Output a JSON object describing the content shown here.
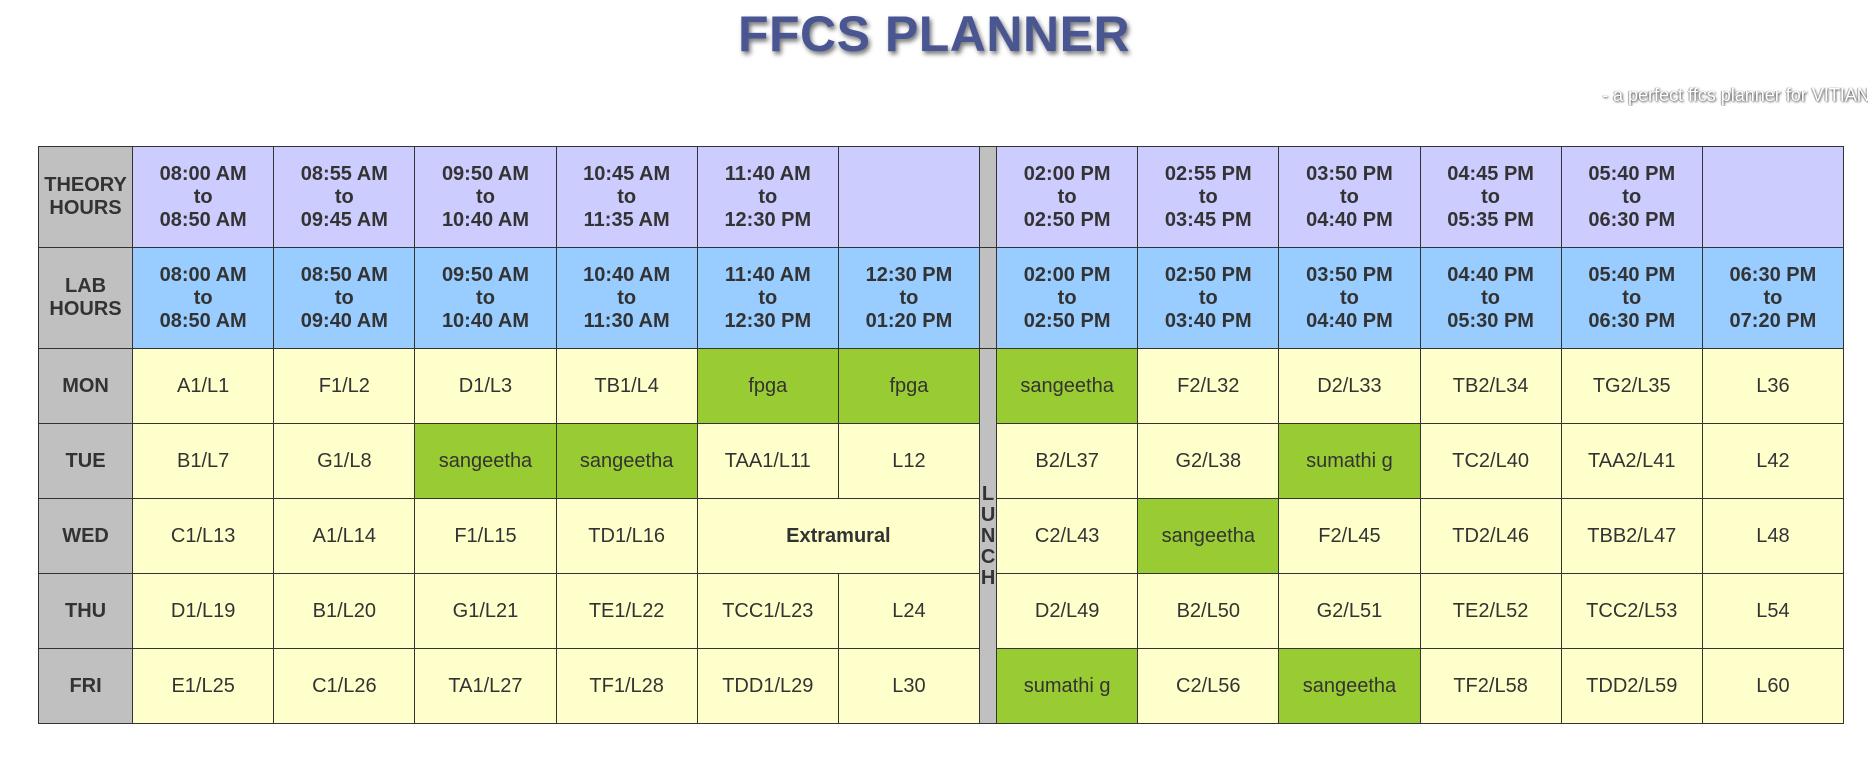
{
  "header": {
    "title": "FFCS PLANNER",
    "subtitle": "- a perfect ffcs planner for VITIAN"
  },
  "colors": {
    "label_gray": "#c0c0c0",
    "theory_purple": "#ccccff",
    "lab_blue": "#99ccff",
    "slot_yellow": "#ffffcc",
    "selected_green": "#99cc33",
    "extramural_red": "#b31b1b",
    "title_blue": "#4a5692"
  },
  "theory_row": {
    "label_1": "THEORY",
    "label_2": "HOURS",
    "times": [
      {
        "start": "08:00 AM",
        "to": "to",
        "end": "08:50 AM"
      },
      {
        "start": "08:55 AM",
        "to": "to",
        "end": "09:45 AM"
      },
      {
        "start": "09:50 AM",
        "to": "to",
        "end": "10:40 AM"
      },
      {
        "start": "10:45 AM",
        "to": "to",
        "end": "11:35 AM"
      },
      {
        "start": "11:40 AM",
        "to": "to",
        "end": "12:30 PM"
      },
      {
        "start": "",
        "to": "",
        "end": ""
      },
      {
        "start": "02:00 PM",
        "to": "to",
        "end": "02:50 PM"
      },
      {
        "start": "02:55 PM",
        "to": "to",
        "end": "03:45 PM"
      },
      {
        "start": "03:50 PM",
        "to": "to",
        "end": "04:40 PM"
      },
      {
        "start": "04:45 PM",
        "to": "to",
        "end": "05:35 PM"
      },
      {
        "start": "05:40 PM",
        "to": "to",
        "end": "06:30 PM"
      },
      {
        "start": "",
        "to": "",
        "end": ""
      }
    ]
  },
  "lab_row": {
    "label_1": "LAB",
    "label_2": "HOURS",
    "times": [
      {
        "start": "08:00 AM",
        "to": "to",
        "end": "08:50 AM"
      },
      {
        "start": "08:50 AM",
        "to": "to",
        "end": "09:40 AM"
      },
      {
        "start": "09:50 AM",
        "to": "to",
        "end": "10:40 AM"
      },
      {
        "start": "10:40 AM",
        "to": "to",
        "end": "11:30 AM"
      },
      {
        "start": "11:40 AM",
        "to": "to",
        "end": "12:30 PM"
      },
      {
        "start": "12:30 PM",
        "to": "to",
        "end": "01:20 PM"
      },
      {
        "start": "02:00 PM",
        "to": "to",
        "end": "02:50 PM"
      },
      {
        "start": "02:50 PM",
        "to": "to",
        "end": "03:40 PM"
      },
      {
        "start": "03:50 PM",
        "to": "to",
        "end": "04:40 PM"
      },
      {
        "start": "04:40 PM",
        "to": "to",
        "end": "05:30 PM"
      },
      {
        "start": "05:40 PM",
        "to": "to",
        "end": "06:30 PM"
      },
      {
        "start": "06:30 PM",
        "to": "to",
        "end": "07:20 PM"
      }
    ]
  },
  "lunch": {
    "letters": [
      "L",
      "U",
      "N",
      "C",
      "H"
    ]
  },
  "extramural": "Extramural",
  "days": [
    {
      "name": "MON",
      "slots": [
        {
          "text": "A1/L1",
          "selected": false
        },
        {
          "text": "F1/L2",
          "selected": false
        },
        {
          "text": "D1/L3",
          "selected": false
        },
        {
          "text": "TB1/L4",
          "selected": false
        },
        {
          "text": "fpga",
          "selected": true
        },
        {
          "text": "fpga",
          "selected": true
        },
        {
          "text": "sangeetha",
          "selected": true
        },
        {
          "text": "F2/L32",
          "selected": false
        },
        {
          "text": "D2/L33",
          "selected": false
        },
        {
          "text": "TB2/L34",
          "selected": false
        },
        {
          "text": "TG2/L35",
          "selected": false
        },
        {
          "text": "L36",
          "selected": false
        }
      ]
    },
    {
      "name": "TUE",
      "slots": [
        {
          "text": "B1/L7",
          "selected": false
        },
        {
          "text": "G1/L8",
          "selected": false
        },
        {
          "text": "sangeetha",
          "selected": true
        },
        {
          "text": "sangeetha",
          "selected": true
        },
        {
          "text": "TAA1/L11",
          "selected": false
        },
        {
          "text": "L12",
          "selected": false
        },
        {
          "text": "B2/L37",
          "selected": false
        },
        {
          "text": "G2/L38",
          "selected": false
        },
        {
          "text": "sumathi g",
          "selected": true
        },
        {
          "text": "TC2/L40",
          "selected": false
        },
        {
          "text": "TAA2/L41",
          "selected": false
        },
        {
          "text": "L42",
          "selected": false
        }
      ]
    },
    {
      "name": "WED",
      "slots": [
        {
          "text": "C1/L13",
          "selected": false
        },
        {
          "text": "A1/L14",
          "selected": false
        },
        {
          "text": "F1/L15",
          "selected": false
        },
        {
          "text": "TD1/L16",
          "selected": false
        },
        {
          "text": "C2/L43",
          "selected": false
        },
        {
          "text": "sangeetha",
          "selected": true
        },
        {
          "text": "F2/L45",
          "selected": false
        },
        {
          "text": "TD2/L46",
          "selected": false
        },
        {
          "text": "TBB2/L47",
          "selected": false
        },
        {
          "text": "L48",
          "selected": false
        }
      ]
    },
    {
      "name": "THU",
      "slots": [
        {
          "text": "D1/L19",
          "selected": false
        },
        {
          "text": "B1/L20",
          "selected": false
        },
        {
          "text": "G1/L21",
          "selected": false
        },
        {
          "text": "TE1/L22",
          "selected": false
        },
        {
          "text": "TCC1/L23",
          "selected": false
        },
        {
          "text": "L24",
          "selected": false
        },
        {
          "text": "D2/L49",
          "selected": false
        },
        {
          "text": "B2/L50",
          "selected": false
        },
        {
          "text": "G2/L51",
          "selected": false
        },
        {
          "text": "TE2/L52",
          "selected": false
        },
        {
          "text": "TCC2/L53",
          "selected": false
        },
        {
          "text": "L54",
          "selected": false
        }
      ]
    },
    {
      "name": "FRI",
      "slots": [
        {
          "text": "E1/L25",
          "selected": false
        },
        {
          "text": "C1/L26",
          "selected": false
        },
        {
          "text": "TA1/L27",
          "selected": false
        },
        {
          "text": "TF1/L28",
          "selected": false
        },
        {
          "text": "TDD1/L29",
          "selected": false
        },
        {
          "text": "L30",
          "selected": false
        },
        {
          "text": "sumathi g",
          "selected": true
        },
        {
          "text": "C2/L56",
          "selected": false
        },
        {
          "text": "sangeetha",
          "selected": true
        },
        {
          "text": "TF2/L58",
          "selected": false
        },
        {
          "text": "TDD2/L59",
          "selected": false
        },
        {
          "text": "L60",
          "selected": false
        }
      ]
    }
  ]
}
